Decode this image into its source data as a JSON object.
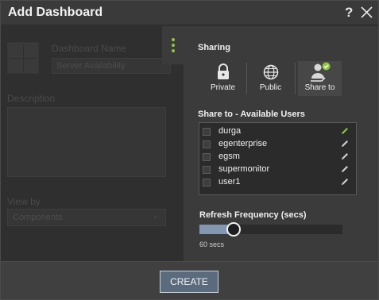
{
  "dialog": {
    "title": "Add Dashboard",
    "help_label": "?"
  },
  "form": {
    "name_label": "Dashboard Name",
    "name_value": "Server Availability",
    "description_label": "Description",
    "viewby_label": "View by",
    "viewby_value": "Components"
  },
  "sharing": {
    "label": "Sharing",
    "options": [
      {
        "label": "Private",
        "icon": "lock-icon"
      },
      {
        "label": "Public",
        "icon": "globe-icon"
      },
      {
        "label": "Share to",
        "icon": "share-user-icon",
        "selected": true
      }
    ],
    "users_label": "Share to - Available Users",
    "users": [
      {
        "name": "durga",
        "highlight": true
      },
      {
        "name": "egenterprise"
      },
      {
        "name": "egsm"
      },
      {
        "name": "supermonitor"
      },
      {
        "name": "user1"
      }
    ]
  },
  "refresh": {
    "label": "Refresh Frequency (secs)",
    "value_text": "60 secs",
    "fraction": 0.24
  },
  "footer": {
    "create_label": "CREATE"
  },
  "colors": {
    "accent_green": "#8dc63f",
    "slider_fill": "#8497b0",
    "button_bg": "#5b6b7e"
  }
}
